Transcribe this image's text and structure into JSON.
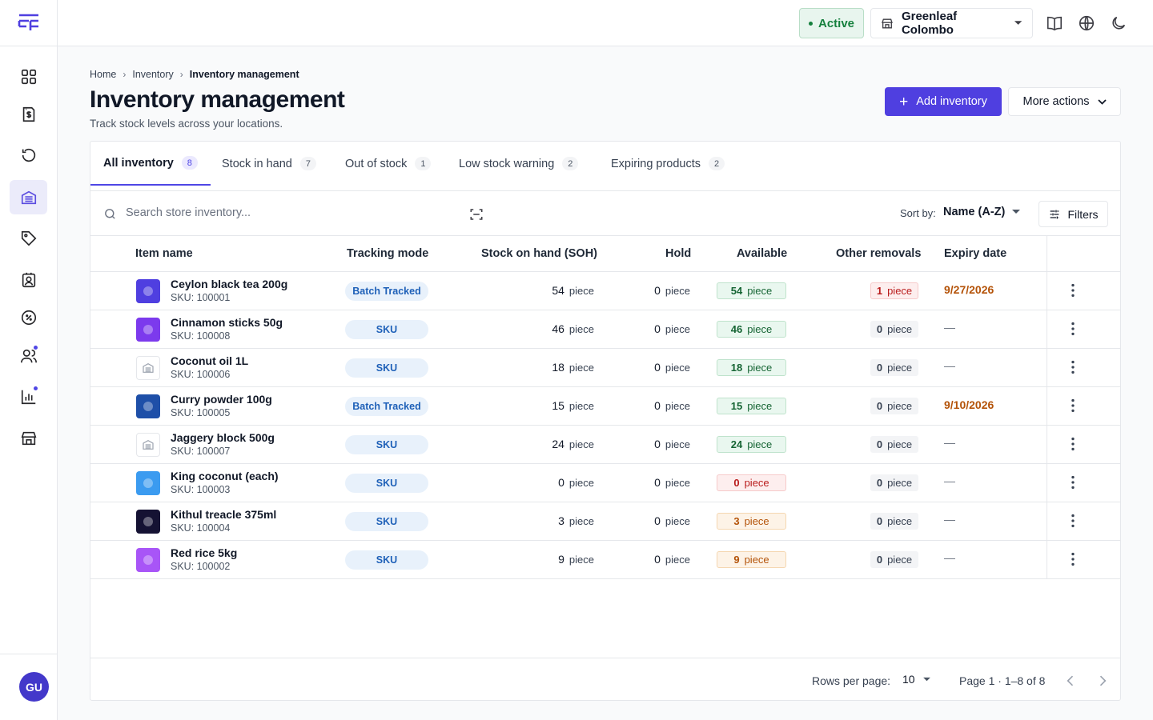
{
  "topbar": {
    "status_label": "Active",
    "store_name": "Greenleaf Colombo"
  },
  "sidebar": {
    "items": [
      {
        "name": "dashboard",
        "icon": "grid-icon",
        "active": false
      },
      {
        "name": "billing",
        "icon": "invoice-icon",
        "active": false
      },
      {
        "name": "history",
        "icon": "refresh-icon",
        "active": false
      },
      {
        "name": "inventory",
        "icon": "inventory-icon",
        "active": true
      },
      {
        "name": "promotions",
        "icon": "tag-icon",
        "active": false
      },
      {
        "name": "staff",
        "icon": "id-badge-icon",
        "active": false
      },
      {
        "name": "discounts",
        "icon": "percent-icon",
        "active": false
      },
      {
        "name": "customers",
        "icon": "users-icon",
        "active": false
      },
      {
        "name": "reports",
        "icon": "chart-icon",
        "active": false
      },
      {
        "name": "stores",
        "icon": "store-icon",
        "active": false
      }
    ],
    "avatar_initials": "GU"
  },
  "breadcrumb": [
    "Home",
    "Inventory",
    "Inventory management"
  ],
  "page": {
    "title": "Inventory management",
    "subtitle": "Track stock levels across your locations.",
    "add_button": "Add inventory",
    "more_button": "More actions"
  },
  "tabs": [
    {
      "label": "All inventory",
      "count": "8",
      "active": true
    },
    {
      "label": "Stock in hand",
      "count": "7",
      "active": false
    },
    {
      "label": "Out of stock",
      "count": "1",
      "active": false
    },
    {
      "label": "Low stock warning",
      "count": "2",
      "active": false
    },
    {
      "label": "Expiring products",
      "count": "2",
      "active": false
    }
  ],
  "toolbar": {
    "search_placeholder": "Search store inventory...",
    "sort_label": "Sort by:",
    "sort_value": "Name (A-Z)",
    "filters_label": "Filters"
  },
  "table": {
    "headers": {
      "item": "Item name",
      "mode": "Tracking mode",
      "soh": "Stock on hand (SOH)",
      "hold": "Hold",
      "available": "Available",
      "removals": "Other removals",
      "expiry": "Expiry date"
    },
    "unit": "piece",
    "rows": [
      {
        "name": "Ceylon black tea 200g",
        "sku": "SKU: 100001",
        "mode": "Batch Tracked",
        "soh": "54",
        "hold": "0",
        "available": "54",
        "available_status": "green",
        "removals": "1",
        "removals_status": "red",
        "expiry": "9/27/2026",
        "thumb_color": "#4f3fe0"
      },
      {
        "name": "Cinnamon sticks 50g",
        "sku": "SKU: 100008",
        "mode": "SKU",
        "soh": "46",
        "hold": "0",
        "available": "46",
        "available_status": "green",
        "removals": "0",
        "removals_status": "grey",
        "expiry": "—",
        "thumb_color": "#7c3aed"
      },
      {
        "name": "Coconut oil 1L",
        "sku": "SKU: 100006",
        "mode": "SKU",
        "soh": "18",
        "hold": "0",
        "available": "18",
        "available_status": "green",
        "removals": "0",
        "removals_status": "grey",
        "expiry": "—",
        "thumb_color": ""
      },
      {
        "name": "Curry powder 100g",
        "sku": "SKU: 100005",
        "mode": "Batch Tracked",
        "soh": "15",
        "hold": "0",
        "available": "15",
        "available_status": "green",
        "removals": "0",
        "removals_status": "grey",
        "expiry": "9/10/2026",
        "thumb_color": "#1e4fa8"
      },
      {
        "name": "Jaggery block 500g",
        "sku": "SKU: 100007",
        "mode": "SKU",
        "soh": "24",
        "hold": "0",
        "available": "24",
        "available_status": "green",
        "removals": "0",
        "removals_status": "grey",
        "expiry": "—",
        "thumb_color": ""
      },
      {
        "name": "King coconut (each)",
        "sku": "SKU: 100003",
        "mode": "SKU",
        "soh": "0",
        "hold": "0",
        "available": "0",
        "available_status": "red",
        "removals": "0",
        "removals_status": "grey",
        "expiry": "—",
        "thumb_color": "#3b9bf0"
      },
      {
        "name": "Kithul treacle 375ml",
        "sku": "SKU: 100004",
        "mode": "SKU",
        "soh": "3",
        "hold": "0",
        "available": "3",
        "available_status": "orange",
        "removals": "0",
        "removals_status": "grey",
        "expiry": "—",
        "thumb_color": "#151233"
      },
      {
        "name": "Red rice 5kg",
        "sku": "SKU: 100002",
        "mode": "SKU",
        "soh": "9",
        "hold": "0",
        "available": "9",
        "available_status": "orange",
        "removals": "0",
        "removals_status": "grey",
        "expiry": "—",
        "thumb_color": "#a855f7"
      }
    ]
  },
  "pagination": {
    "rows_label": "Rows per page:",
    "rows_value": "10",
    "page_info": "Page 1 · 1–8 of 8"
  },
  "colors": {
    "accent": "#4f3fe0",
    "active_status": "#15803d",
    "expiry": "#b45309"
  }
}
